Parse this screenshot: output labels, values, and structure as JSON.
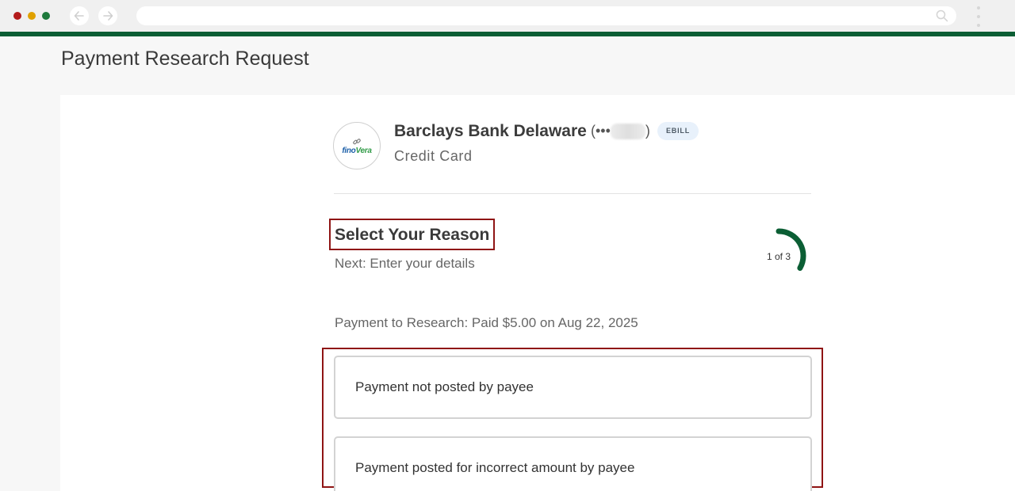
{
  "page": {
    "title": "Payment Research Request"
  },
  "payee": {
    "logo_text_part1": "fino",
    "logo_text_part2": "Vera",
    "name": "Barclays Bank Delaware",
    "masked_prefix": "(•••",
    "masked_suffix": ")",
    "badge": "EBILL",
    "type": "Credit Card"
  },
  "step": {
    "title": "Select Your Reason",
    "next": "Next: Enter your details",
    "progress_label": "1 of 3",
    "current": 1,
    "total": 3
  },
  "payment": {
    "research_line": "Payment to Research: Paid $5.00 on Aug 22, 2025"
  },
  "options": [
    {
      "label": "Payment not posted by payee"
    },
    {
      "label": "Payment posted for incorrect amount by payee"
    }
  ],
  "colors": {
    "accent_green": "#0b5e34",
    "highlight_red": "#8f1414"
  }
}
